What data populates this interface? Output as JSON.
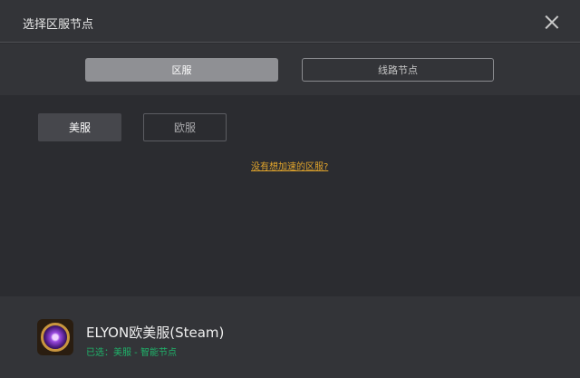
{
  "window": {
    "title": "选择区服节点",
    "close_icon": "close-icon"
  },
  "tabs": [
    {
      "label": "区服",
      "active": true
    },
    {
      "label": "线路节点",
      "active": false
    }
  ],
  "regions": [
    {
      "label": "美服",
      "selected": true
    },
    {
      "label": "欧服",
      "selected": false
    }
  ],
  "missing_region_link": "没有想加速的区服?",
  "footer": {
    "game_icon": "game-icon",
    "game_name": "ELYON欧美服(Steam)",
    "selection": "已选：美服 - 智能节点"
  },
  "colors": {
    "background": "#2b2c30",
    "panel": "#333438",
    "link": "#e0a42c",
    "status_green": "#1fb36a"
  }
}
